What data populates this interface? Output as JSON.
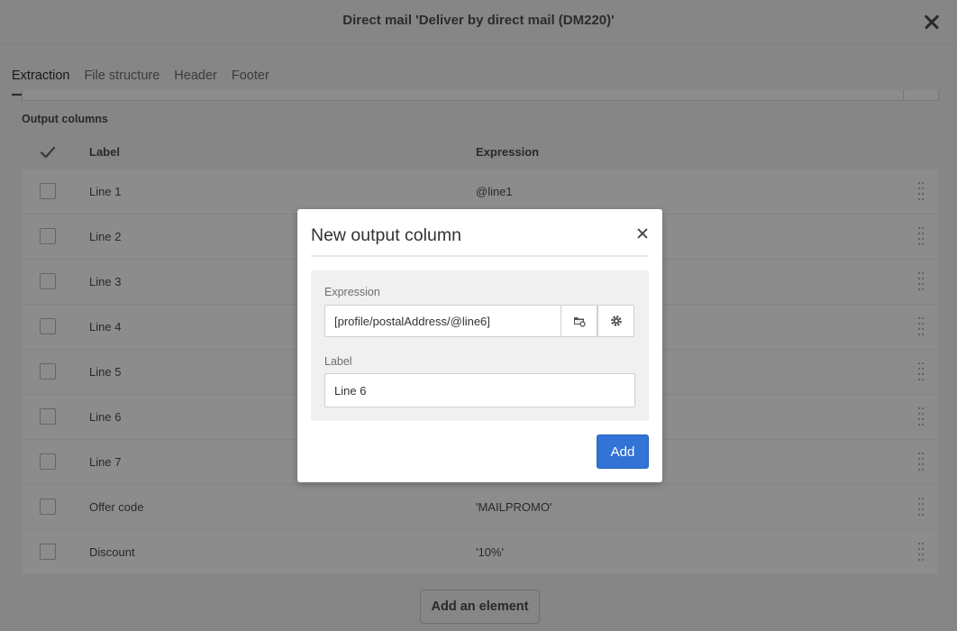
{
  "window": {
    "title": "Direct mail 'Deliver by direct mail (DM220)'"
  },
  "tabs": [
    {
      "label": "Extraction",
      "active": true
    },
    {
      "label": "File structure",
      "active": false
    },
    {
      "label": "Header",
      "active": false
    },
    {
      "label": "Footer",
      "active": false
    }
  ],
  "output_columns": {
    "section_label": "Output columns",
    "headers": {
      "check": "check-icon",
      "label": "Label",
      "expression": "Expression"
    },
    "rows": [
      {
        "label": "Line 1",
        "expression": "@line1"
      },
      {
        "label": "Line 2",
        "expression": ""
      },
      {
        "label": "Line 3",
        "expression": ""
      },
      {
        "label": "Line 4",
        "expression": ""
      },
      {
        "label": "Line 5",
        "expression": ""
      },
      {
        "label": "Line 6",
        "expression": ""
      },
      {
        "label": "Line 7",
        "expression": ""
      },
      {
        "label": "Offer code",
        "expression": "'MAILPROMO'"
      },
      {
        "label": "Discount",
        "expression": "'10%'"
      }
    ],
    "add_button": "Add an element"
  },
  "modal": {
    "title": "New output column",
    "expression_label": "Expression",
    "expression_value": "[profile/postalAddress/@line6]",
    "label_label": "Label",
    "label_value": "Line 6",
    "add_button": "Add"
  },
  "colors": {
    "accent": "#3273d6",
    "overlay": "rgba(0,0,0,0.45)"
  }
}
